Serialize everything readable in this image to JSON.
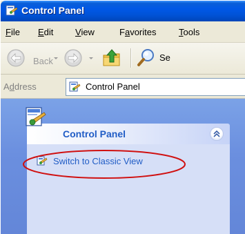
{
  "window": {
    "title": "Control Panel",
    "title_icon": "control-panel-icon"
  },
  "menu": {
    "items": [
      {
        "underline": "F",
        "rest": "ile"
      },
      {
        "underline": "E",
        "rest": "dit"
      },
      {
        "underline": "V",
        "rest": "iew"
      },
      {
        "pre": "F",
        "underline": "a",
        "rest": "vorites"
      },
      {
        "underline": "T",
        "rest": "ools"
      }
    ]
  },
  "toolbar": {
    "back_label": "Back",
    "back_icon": "back-arrow-icon",
    "forward_icon": "forward-arrow-icon",
    "up_icon": "up-folder-icon",
    "search_icon": "search-magnifier-icon",
    "search_label": "Se"
  },
  "address": {
    "label_pre": "A",
    "label_underline": "d",
    "label_rest": "dress",
    "value": "Control Panel",
    "icon": "control-panel-icon"
  },
  "task_pane": {
    "header_title": "Control Panel",
    "header_icon": "control-panel-icon",
    "collapse_icon": "double-chevron-up-icon",
    "link_label": "Switch to Classic View",
    "link_icon": "control-panel-icon",
    "annotation_color": "#d01010"
  },
  "colors": {
    "title_bar": "#0058e6",
    "pane_bg": "#6b8fdf",
    "link": "#215dc6",
    "panel_body": "#d6dff7"
  }
}
